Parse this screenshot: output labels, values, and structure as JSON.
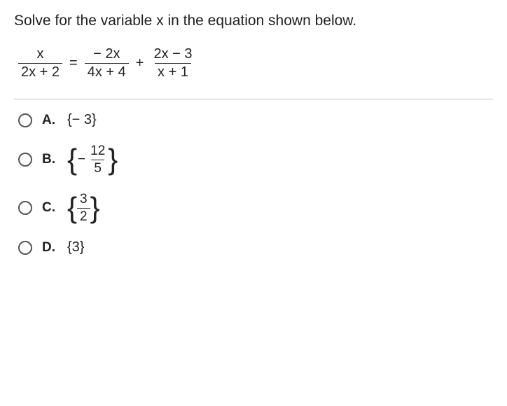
{
  "prompt": "Solve for the variable x in the equation shown below.",
  "equation": {
    "f1": {
      "num": "x",
      "den": "2x + 2"
    },
    "eq": "=",
    "f2": {
      "num": "− 2x",
      "den": "4x + 4"
    },
    "plus": "+",
    "f3": {
      "num": "2x − 3",
      "den": "x + 1"
    }
  },
  "options": {
    "A": {
      "letter": "A.",
      "text": "{− 3}"
    },
    "B": {
      "letter": "B.",
      "neg": "−",
      "num": "12",
      "den": "5"
    },
    "C": {
      "letter": "C.",
      "num": "3",
      "den": "2"
    },
    "D": {
      "letter": "D.",
      "text": "{3}"
    }
  },
  "chart_data": {
    "type": "table",
    "title": "Multiple-choice answers",
    "categories": [
      "A",
      "B",
      "C",
      "D"
    ],
    "values": [
      "{-3}",
      "{-12/5}",
      "{3/2}",
      "{3}"
    ]
  }
}
